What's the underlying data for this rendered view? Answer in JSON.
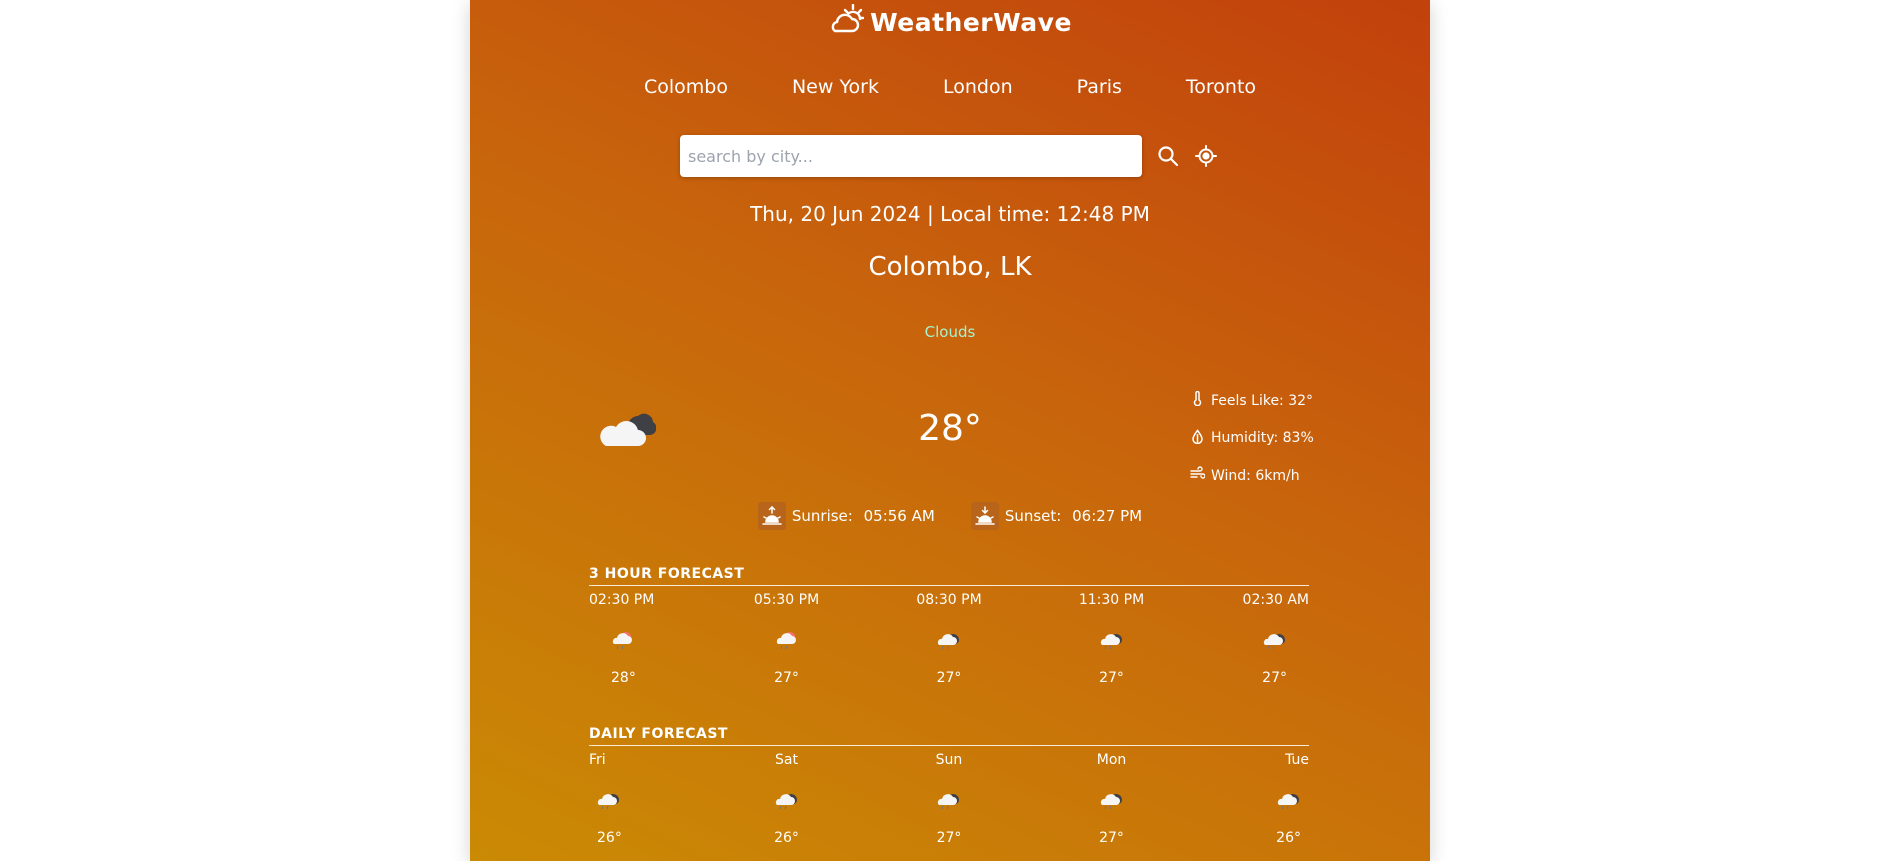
{
  "app": {
    "name": "WeatherWave"
  },
  "nav": {
    "cities": [
      "Colombo",
      "New York",
      "London",
      "Paris",
      "Toronto"
    ]
  },
  "search": {
    "placeholder": "search by city...",
    "value": ""
  },
  "current": {
    "date": "Thu, 20 Jun 2024",
    "separator": " | ",
    "local_time_label": "Local time: ",
    "local_time": "12:48 PM",
    "location": "Colombo, LK",
    "condition": "Clouds",
    "temperature": "28°",
    "icon": "cloud-icon",
    "feels_like": "Feels Like: 32°",
    "humidity": "Humidity: 83%",
    "wind": "Wind: 6km/h",
    "sunrise_label": "Sunrise: ",
    "sunrise": "05:56 AM",
    "sunset_label": "Sunset: ",
    "sunset": "06:27 PM"
  },
  "hourly": {
    "title": "3 HOUR FORECAST",
    "items": [
      {
        "label": "02:30 PM",
        "temp": "28°",
        "icon": "cloud-sun-rain-icon"
      },
      {
        "label": "05:30 PM",
        "temp": "27°",
        "icon": "cloud-sun-rain-icon"
      },
      {
        "label": "08:30 PM",
        "temp": "27°",
        "icon": "cloud-rain-icon"
      },
      {
        "label": "11:30 PM",
        "temp": "27°",
        "icon": "cloud-rain-icon"
      },
      {
        "label": "02:30 AM",
        "temp": "27°",
        "icon": "cloud-rain-icon"
      }
    ]
  },
  "daily": {
    "title": "DAILY FORECAST",
    "items": [
      {
        "label": "Fri",
        "temp": "26°",
        "icon": "cloud-rain-icon"
      },
      {
        "label": "Sat",
        "temp": "26°",
        "icon": "cloud-rain-icon"
      },
      {
        "label": "Sun",
        "temp": "27°",
        "icon": "cloud-rain-icon"
      },
      {
        "label": "Mon",
        "temp": "27°",
        "icon": "cloud-rain-icon"
      },
      {
        "label": "Tue",
        "temp": "26°",
        "icon": "cloud-rain-icon"
      }
    ]
  },
  "colors": {
    "gradient_top": "#c2410c",
    "gradient_bottom": "#ca8a04",
    "condition_text": "#a7f3d0"
  }
}
